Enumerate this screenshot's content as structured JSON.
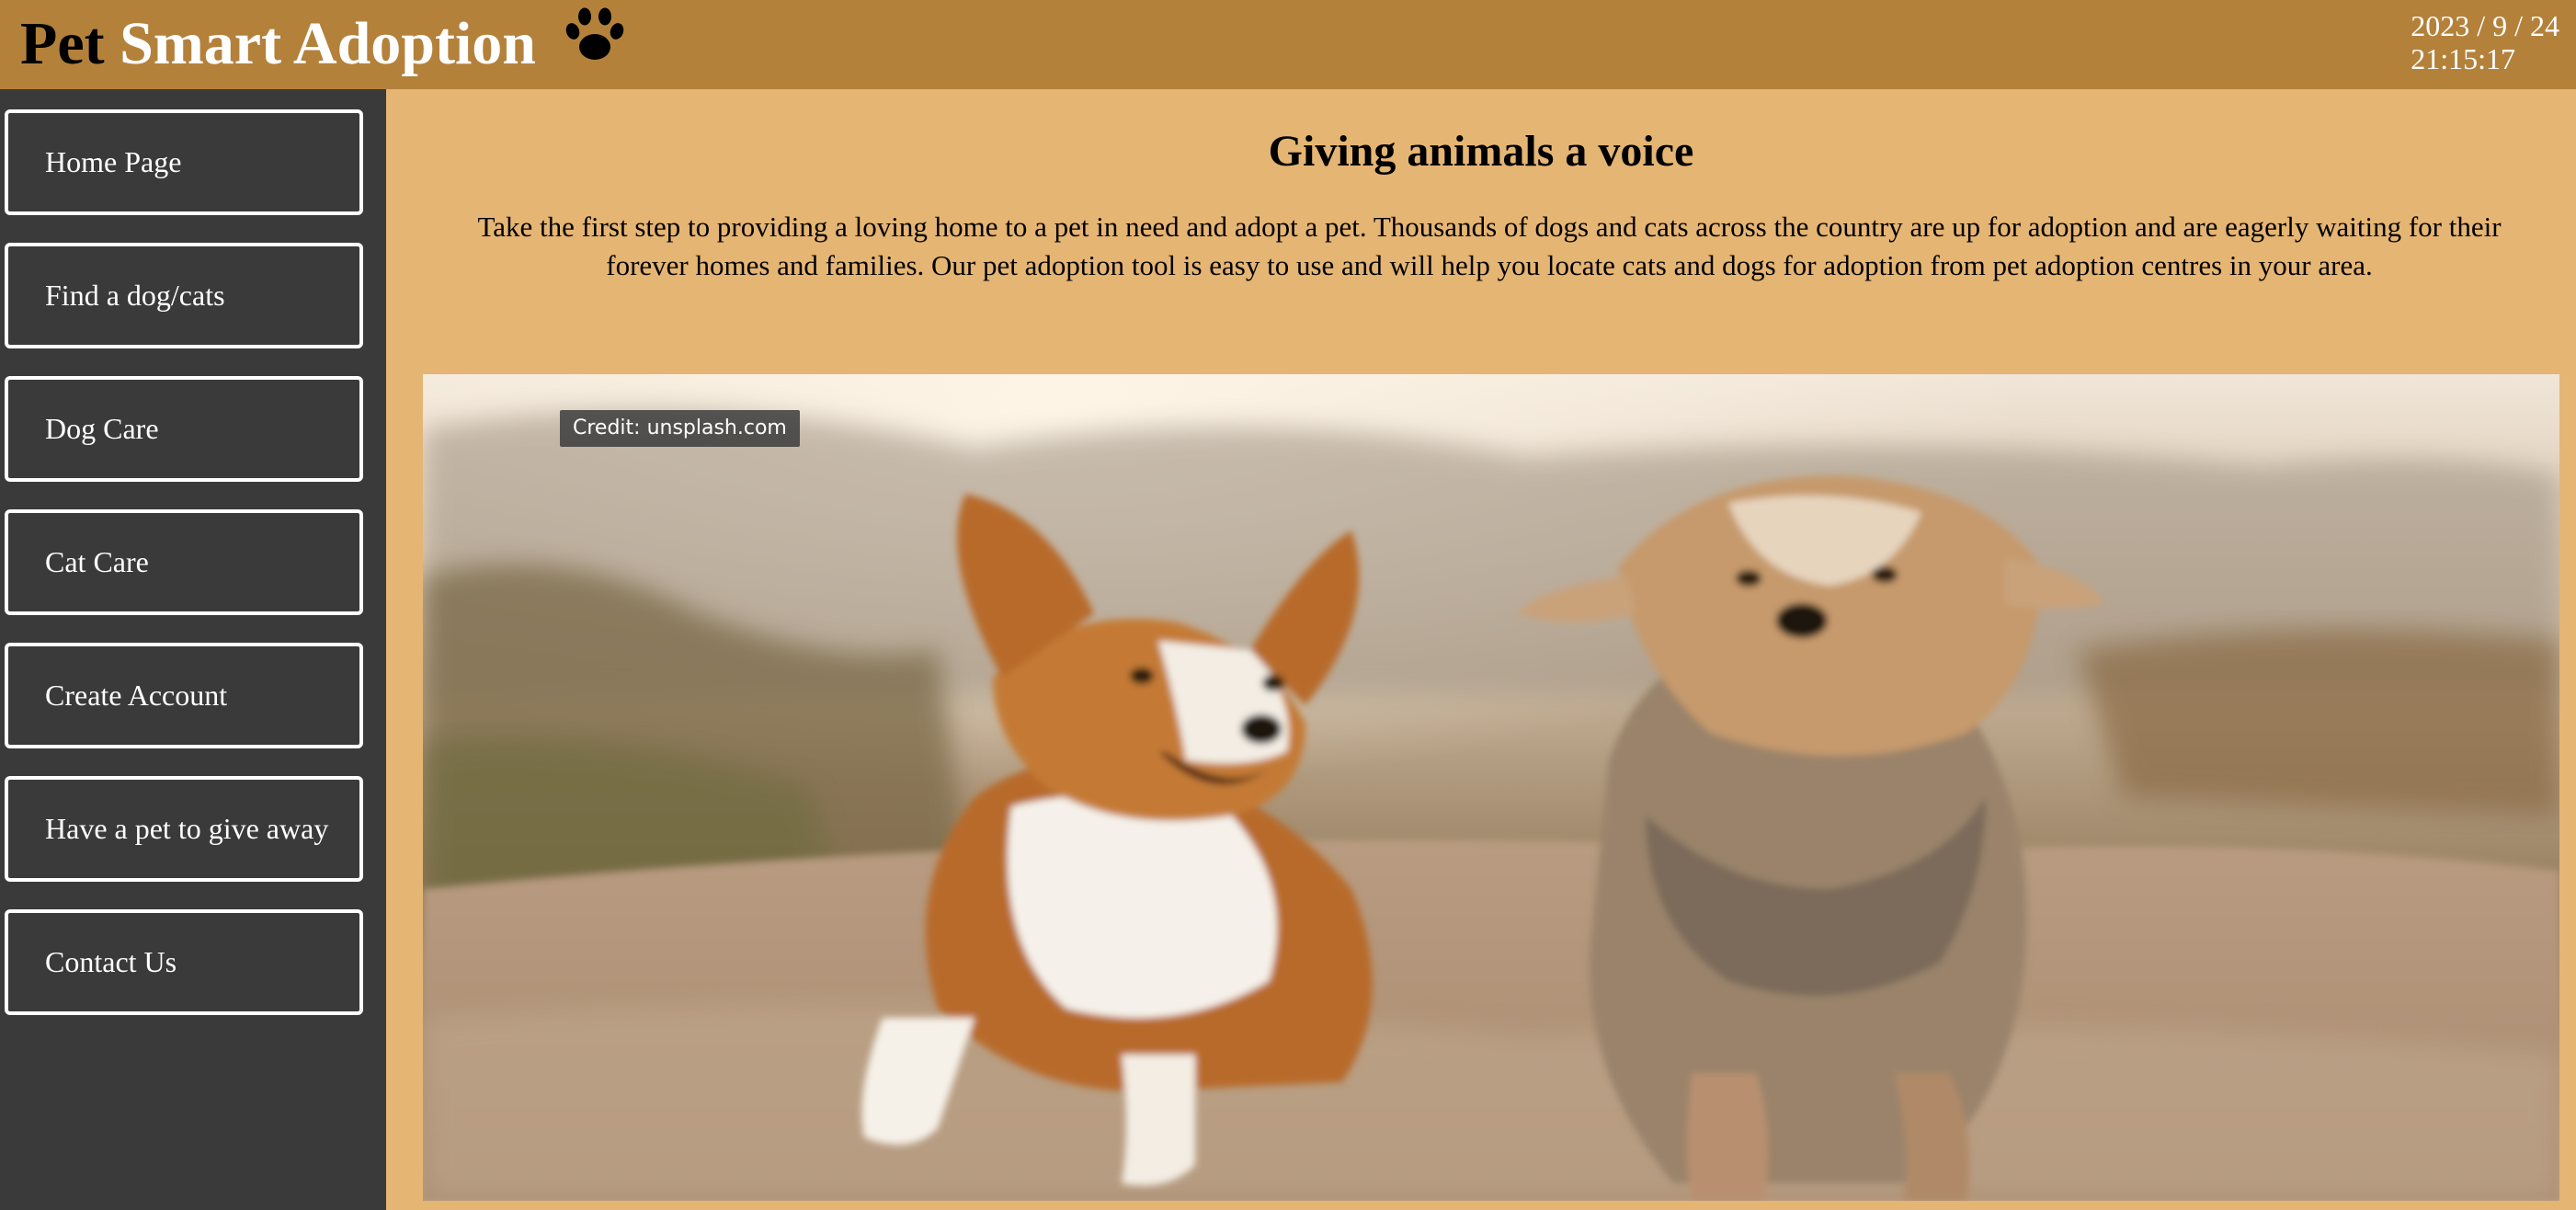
{
  "header": {
    "title_part1": "Pet",
    "title_part2": "Smart Adoption",
    "logo_icon": "paw-icon",
    "date": "2023 / 9 / 24",
    "time": "21:15:17"
  },
  "sidebar": {
    "items": [
      {
        "label": "Home Page"
      },
      {
        "label": "Find a dog/cats"
      },
      {
        "label": "Dog Care"
      },
      {
        "label": "Cat Care"
      },
      {
        "label": "Create Account"
      },
      {
        "label": "Have a pet to give away"
      },
      {
        "label": "Contact Us"
      }
    ]
  },
  "main": {
    "heading": "Giving animals a voice",
    "intro": "Take the first step to providing a loving home to a pet in need and adopt a pet. Thousands of dogs and cats across the country are up for adoption and are eagerly waiting for their forever homes and families. Our pet adoption tool is easy to use and will help you locate cats and dogs for adoption from pet adoption centres in your area.",
    "hero": {
      "credit": "Credit: unsplash.com"
    }
  },
  "colors": {
    "header_bg": "#b4813b",
    "page_bg": "#e5b574",
    "sidebar_bg": "#3a3a3a",
    "nav_border": "#ffffff"
  }
}
